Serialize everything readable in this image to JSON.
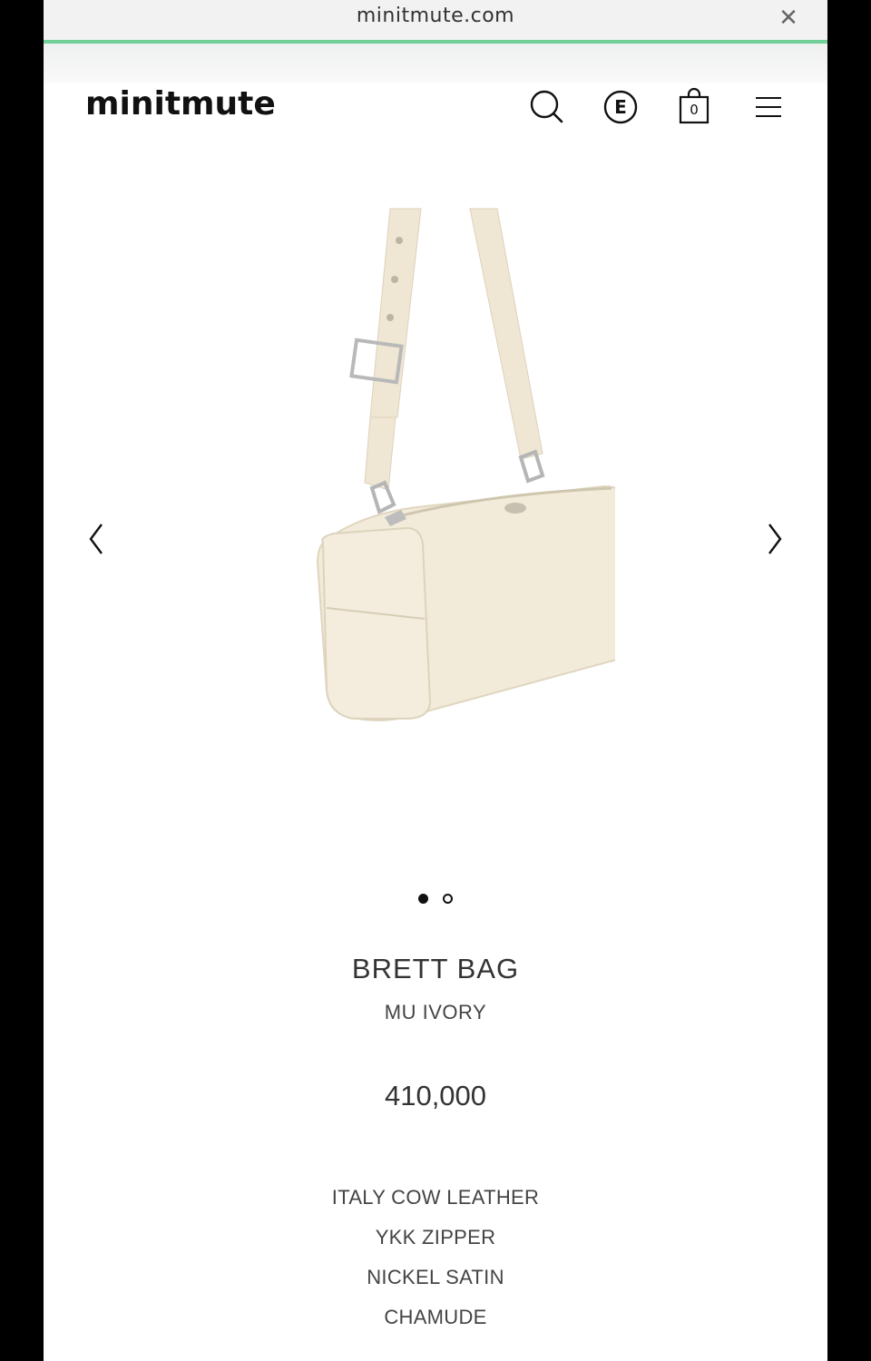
{
  "browser": {
    "url": "minitmute.com",
    "close_icon": "close-icon"
  },
  "header": {
    "logo": "minitmute",
    "search_icon": "search-icon",
    "language_label": "E",
    "cart_count": "0",
    "menu_icon": "hamburger-menu-icon"
  },
  "carousel": {
    "image_alt": "ivory shoulder bag",
    "prev_icon": "chevron-left-icon",
    "next_icon": "chevron-right-icon",
    "slide_count": 2,
    "active_slide": 1
  },
  "product": {
    "name": "BRETT BAG",
    "color": "MU IVORY",
    "price": "410,000",
    "features": [
      "ITALY COW LEATHER",
      "YKK ZIPPER",
      "NICKEL SATIN",
      "CHAMUDE"
    ]
  },
  "colors": {
    "progress": "#6fcf97",
    "bag": "#f1ead8"
  }
}
